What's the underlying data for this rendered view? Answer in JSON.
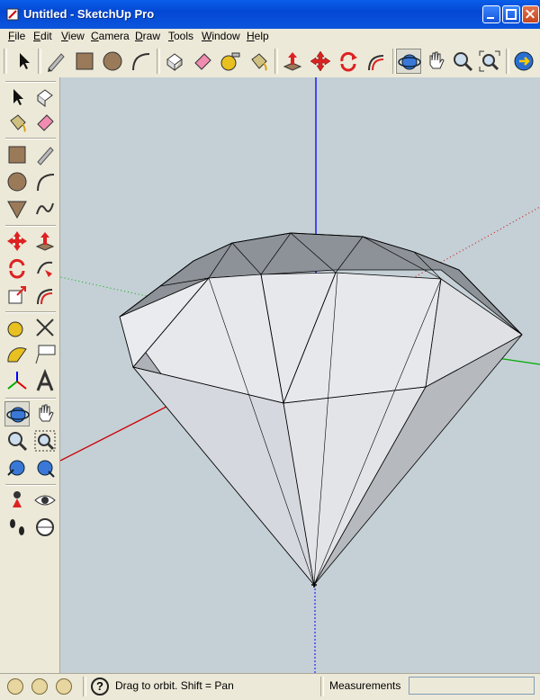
{
  "window": {
    "title": "Untitled - SketchUp Pro"
  },
  "menu": [
    {
      "name": "file",
      "label": "File",
      "u": "F",
      "rest": "ile"
    },
    {
      "name": "edit",
      "label": "Edit",
      "u": "E",
      "rest": "dit"
    },
    {
      "name": "view",
      "label": "View",
      "u": "V",
      "rest": "iew"
    },
    {
      "name": "camera",
      "label": "Camera",
      "u": "C",
      "rest": "amera"
    },
    {
      "name": "draw",
      "label": "Draw",
      "u": "D",
      "rest": "raw"
    },
    {
      "name": "tools",
      "label": "Tools",
      "u": "T",
      "rest": "ools"
    },
    {
      "name": "window",
      "label": "Window",
      "u": "W",
      "rest": "indow"
    },
    {
      "name": "help",
      "label": "Help",
      "u": "H",
      "rest": "elp"
    }
  ],
  "status": {
    "hint": "Drag to orbit.  Shift = Pan",
    "measurements_label": "Measurements",
    "measurements_value": ""
  },
  "colors": {
    "titlebar": "#0348d4",
    "chrome": "#ece9d8",
    "viewport_bg": "#c4d0d6",
    "axis_blue": "#0000ff",
    "axis_red": "#cc0000",
    "axis_green": "#00aa00"
  },
  "toolbar_icons": [
    "select-icon",
    "pencil-icon",
    "rectangle-icon",
    "circle-icon",
    "arc-icon",
    "make-component-icon",
    "eraser-icon",
    "tape-measure-icon",
    "paint-bucket-icon",
    "push-pull-icon",
    "move-icon",
    "rotate-icon",
    "offset-icon",
    "orbit-icon",
    "pan-icon",
    "zoom-icon",
    "zoom-extents-icon",
    "get-models-icon"
  ]
}
